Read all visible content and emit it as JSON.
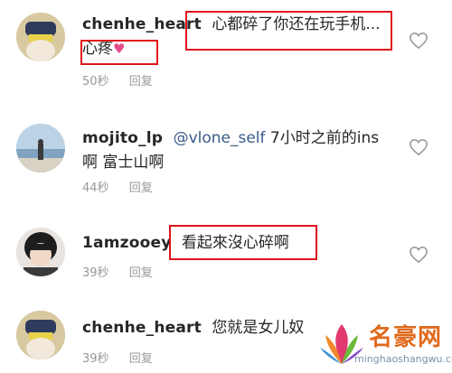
{
  "comments": [
    {
      "username": "chenhe_heart",
      "text_line1": "心都碎了你还在玩手机...",
      "text_line2": "心疼",
      "heart_emoji": "♥",
      "time": "50秒",
      "reply": "回复"
    },
    {
      "username": "mojito_lp",
      "mention": "@vlone_self",
      "text_line1": " 7小时之前的ins",
      "text_line2": "啊 富士山啊",
      "time": "44秒",
      "reply": "回复"
    },
    {
      "username": "1amzooey",
      "text_line1": "看起來沒心碎啊",
      "time": "39秒",
      "reply": "回复"
    },
    {
      "username": "chenhe_heart",
      "text_line1": "您就是女儿奴",
      "time": "39秒",
      "reply": "回复"
    }
  ],
  "watermark": {
    "title": "名豪网",
    "url": "minghaoshangwu.com"
  },
  "colors": {
    "highlight": "#e0131b",
    "mention": "#3b5a8a",
    "meta": "#999999"
  }
}
